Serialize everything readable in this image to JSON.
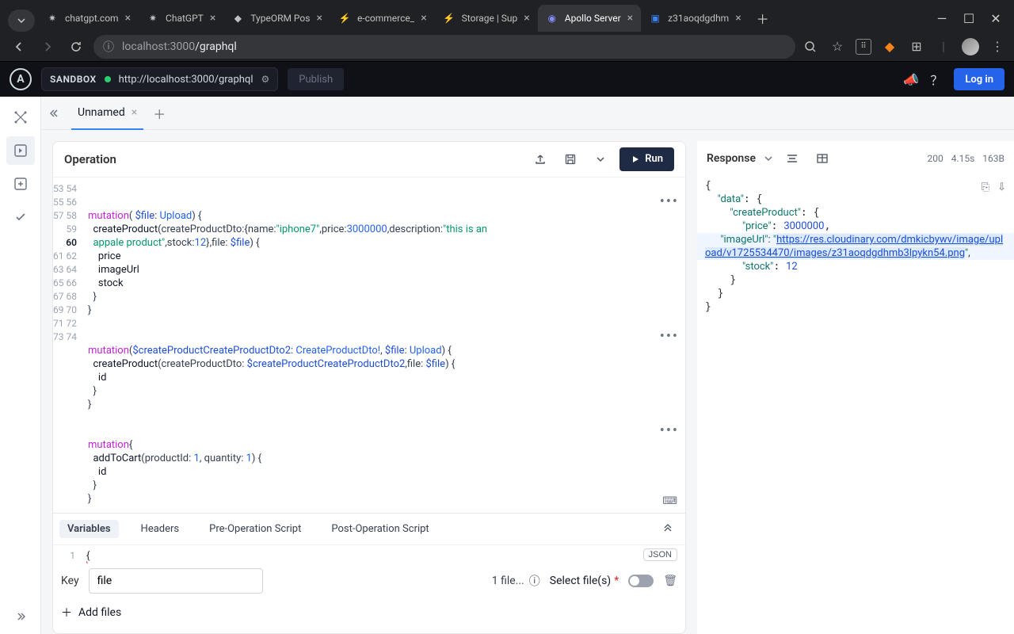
{
  "browser": {
    "tabs": [
      {
        "title": "chatgpt.com",
        "icon": "✷"
      },
      {
        "title": "ChatGPT",
        "icon": "✷"
      },
      {
        "title": "TypeORM Pos",
        "icon": "◆"
      },
      {
        "title": "e-commerce_",
        "icon": "⚡"
      },
      {
        "title": "Storage | Sup",
        "icon": "⚡"
      },
      {
        "title": "Apollo Server",
        "icon": "◉",
        "active": true
      },
      {
        "title": "z31aoqdgdhm",
        "icon": "▣"
      }
    ],
    "url_host": "localhost:3000",
    "url_path": "/graphql"
  },
  "apollo": {
    "sandbox_label": "SANDBOX",
    "endpoint": "http://localhost:3000/graphql",
    "publish_label": "Publish",
    "login_label": "Log in",
    "doc_tab": "Unnamed"
  },
  "operation": {
    "title": "Operation",
    "run_label": "Run",
    "line_start": 53,
    "code_lines": [
      "",
      "mutation( $file: Upload) {",
      "  createProduct(createProductDto:{name:\"iphone7\",price:3000000,description:\"this is an appale product\",stock:12},file: $file) {",
      "    price",
      "    imageUrl",
      "    stock",
      "  }",
      "}",
      "",
      "",
      "mutation($createProductCreateProductDto2: CreateProductDto!, $file: Upload) {",
      "  createProduct(createProductDto: $createProductCreateProductDto2,file: $file) {",
      "    id",
      "  }",
      "}",
      "",
      "",
      "mutation{",
      "  addToCart(productId: 1, quantity: 1) {",
      "    id",
      "  }",
      "}"
    ],
    "gutter": [
      "53",
      "54",
      "55",
      "56",
      "57",
      "58",
      "59",
      "60",
      "61",
      "62",
      "63",
      "64",
      "65",
      "66",
      "67",
      "68",
      "69",
      "70",
      "71",
      "72",
      "73",
      "74"
    ]
  },
  "variables": {
    "tabs": [
      "Variables",
      "Headers",
      "Pre-Operation Script",
      "Post-Operation Script"
    ],
    "json_mode": "JSON",
    "line1_num": "1",
    "line1_text": "{",
    "key_label": "Key",
    "key_value": "file",
    "file_summary": "1 file...",
    "select_label": "Select file(s)",
    "add_files": "Add files"
  },
  "response": {
    "title": "Response",
    "status": "200",
    "time": "4.15s",
    "size": "163B",
    "data": {
      "data_key": "\"data\"",
      "createProduct_key": "\"createProduct\"",
      "price_key": "\"price\"",
      "price_val": "3000000",
      "imageUrl_key": "\"imageUrl\"",
      "imageUrl_val": "https://res.cloudinary.com/dmkicbywv/image/upload/v1725534470/images/z31aoqdgdhmb3lpykn54.png",
      "stock_key": "\"stock\"",
      "stock_val": "12"
    }
  }
}
